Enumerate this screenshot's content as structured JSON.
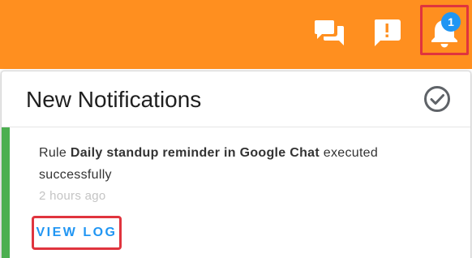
{
  "topbar": {
    "background": "#ff8f1f",
    "icons": [
      {
        "name": "chat-icon"
      },
      {
        "name": "feedback-icon"
      },
      {
        "name": "bell-icon",
        "badge": "1"
      }
    ]
  },
  "notifications": {
    "title": "New Notifications",
    "mark_all_icon": "check-circle-icon",
    "items": [
      {
        "prefix": "Rule ",
        "rule_name": "Daily standup reminder in Google Chat",
        "suffix": " executed successfully",
        "time": "2 hours ago",
        "action_label": "VIEW LOG",
        "status_color": "#4caf50"
      }
    ]
  },
  "colors": {
    "accent": "#2196f3",
    "highlight": "#e0343e"
  }
}
